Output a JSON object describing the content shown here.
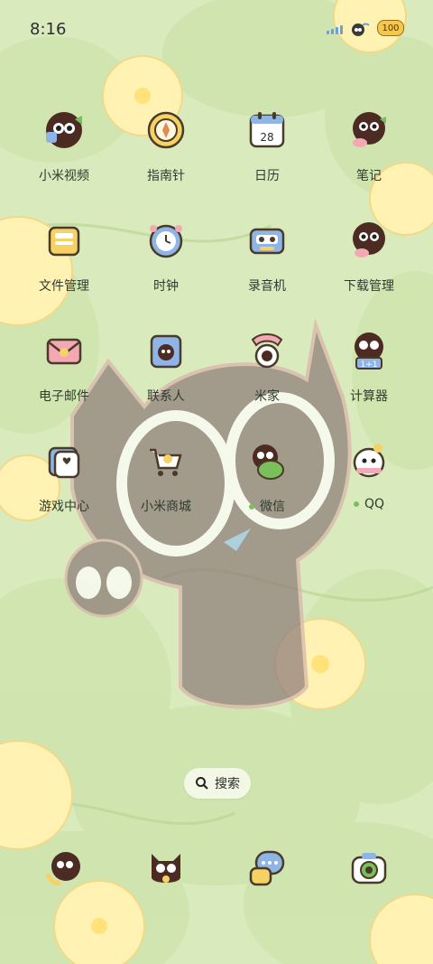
{
  "status_bar": {
    "time": "8:16",
    "battery": "100"
  },
  "apps": [
    {
      "label": "小米视频",
      "icon": "cat-video-icon"
    },
    {
      "label": "指南针",
      "icon": "compass-icon"
    },
    {
      "label": "日历",
      "icon": "calendar-icon",
      "calendar_day": "28"
    },
    {
      "label": "笔记",
      "icon": "cat-notes-icon"
    },
    {
      "label": "文件管理",
      "icon": "file-manager-icon"
    },
    {
      "label": "时钟",
      "icon": "clock-icon"
    },
    {
      "label": "录音机",
      "icon": "recorder-icon"
    },
    {
      "label": "下载管理",
      "icon": "cat-download-icon"
    },
    {
      "label": "电子邮件",
      "icon": "email-icon"
    },
    {
      "label": "联系人",
      "icon": "contacts-icon"
    },
    {
      "label": "米家",
      "icon": "mijia-icon"
    },
    {
      "label": "计算器",
      "icon": "calculator-icon"
    },
    {
      "label": "游戏中心",
      "icon": "game-center-icon"
    },
    {
      "label": "小米商城",
      "icon": "mi-store-icon"
    },
    {
      "label": "微信",
      "icon": "wechat-icon",
      "new_install_dot": true
    },
    {
      "label": "QQ",
      "icon": "qq-icon",
      "new_install_dot": true
    }
  ],
  "search": {
    "label": "搜索"
  },
  "dock": [
    {
      "icon": "cat-phone-icon"
    },
    {
      "icon": "cat-contacts-icon"
    },
    {
      "icon": "messages-icon"
    },
    {
      "icon": "camera-icon"
    }
  ],
  "colors": {
    "wallpaper": "#dcebc3",
    "leaf": "#c8e0a6",
    "flower": "#fff3b8",
    "cat": "#8f7d79",
    "label_text": "#2f3b2f",
    "dot": "#7bbf5b"
  }
}
